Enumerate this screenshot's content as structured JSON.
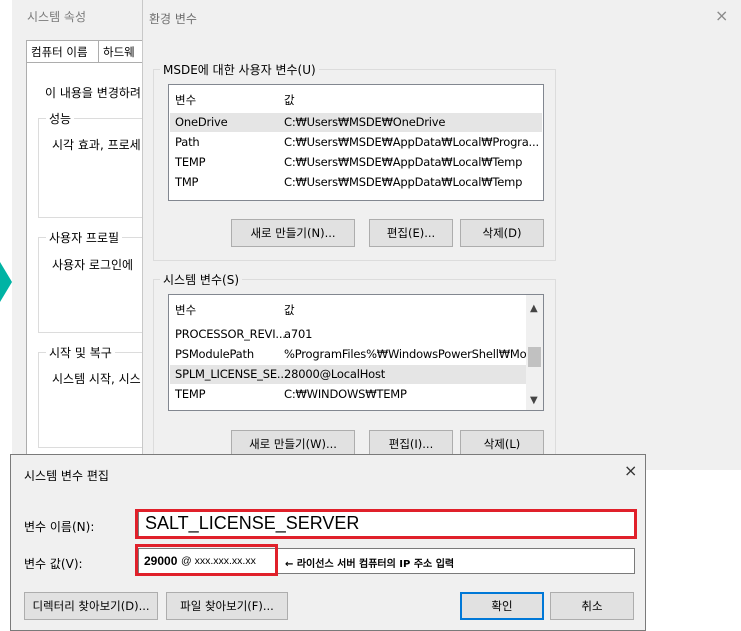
{
  "sysprop": {
    "title": "시스템 속성",
    "tabs": [
      "컴퓨터 이름",
      "하드웨"
    ],
    "intro": "이 내용을 변경하려",
    "performance": {
      "label": "성능",
      "desc": "시각 효과, 프로세"
    },
    "profile": {
      "label": "사용자 프로필",
      "desc": "사용자 로그인에"
    },
    "startup": {
      "label": "시작 및 복구",
      "desc": "시스템 시작, 시스"
    }
  },
  "env": {
    "title": "환경 변수",
    "close_icon": "×",
    "user_group": "MSDE에 대한 사용자 변수(U)",
    "user_columns": [
      "변수",
      "값"
    ],
    "user_vars": [
      {
        "name": "OneDrive",
        "value": "C:₩Users₩MSDE₩OneDrive"
      },
      {
        "name": "Path",
        "value": "C:₩Users₩MSDE₩AppData₩Local₩Progra..."
      },
      {
        "name": "TEMP",
        "value": "C:₩Users₩MSDE₩AppData₩Local₩Temp"
      },
      {
        "name": "TMP",
        "value": "C:₩Users₩MSDE₩AppData₩Local₩Temp"
      }
    ],
    "user_buttons": {
      "new": "새로 만들기(N)...",
      "edit": "편집(E)...",
      "delete": "삭제(D)"
    },
    "system_group": "시스템 변수(S)",
    "system_columns": [
      "변수",
      "값"
    ],
    "system_vars": [
      {
        "name": "PROCESSOR_REVI...",
        "value": "a701"
      },
      {
        "name": "PSModulePath",
        "value": "%ProgramFiles%₩WindowsPowerShell₩Mo..."
      },
      {
        "name": "SPLM_LICENSE_SE...",
        "value": "28000@LocalHost"
      },
      {
        "name": "TEMP",
        "value": "C:₩WINDOWS₩TEMP"
      }
    ],
    "system_buttons": {
      "new": "새로 만들기(W)...",
      "edit": "편집(I)...",
      "delete": "삭제(L)"
    }
  },
  "edit_dialog": {
    "title": "시스템 변수 편집",
    "close_icon": "×",
    "name_label": "변수 이름(N):",
    "name_value": "SALT_LICENSE_SERVER",
    "value_label": "변수 값(V):",
    "value_bold": "29000",
    "value_rest": "@ xxx.xxx.xx.xx",
    "annotation": "← 라이선스 서버 컴퓨터의 IP 주소 입력",
    "browse_dir": "디렉터리 찾아보기(D)...",
    "browse_file": "파일 찾아보기(F)...",
    "ok": "확인",
    "cancel": "취소"
  },
  "colors": {
    "highlight": "#e0202a",
    "accent": "#00b3a4",
    "default_btn_border": "#0078d7"
  }
}
